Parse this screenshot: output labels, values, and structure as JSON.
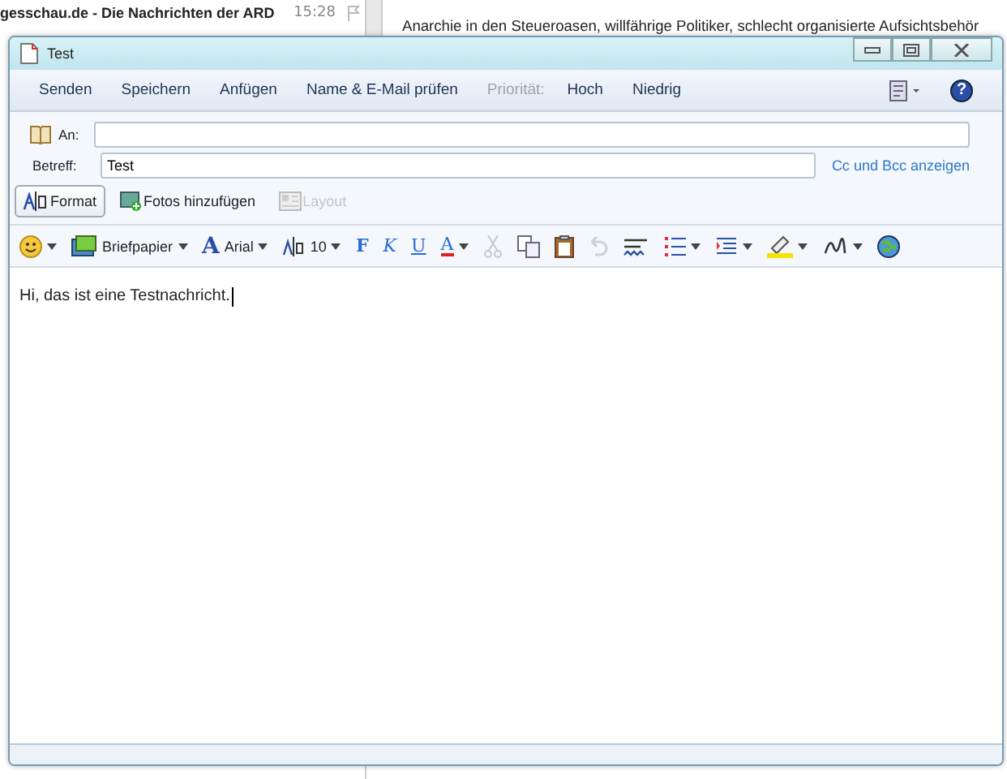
{
  "background": {
    "message_list": {
      "sender": "gesschau.de - Die Nachrichten der ARD",
      "time": "15:28"
    },
    "reading_pane": {
      "text": "Anarchie in den Steueroasen, willfährige Politiker, schlecht organisierte Aufsichtsbehör"
    }
  },
  "window": {
    "title": "Test"
  },
  "command_bar": [
    {
      "kind": "button",
      "label": "Senden"
    },
    {
      "kind": "button",
      "label": "Speichern"
    },
    {
      "kind": "button",
      "label": "Anfügen"
    },
    {
      "kind": "button",
      "label": "Name & E-Mail prüfen"
    },
    {
      "kind": "label",
      "label": "Priorität:"
    },
    {
      "kind": "button",
      "label": "Hoch"
    },
    {
      "kind": "button",
      "label": "Niedrig"
    }
  ],
  "help_button": {
    "label": "?"
  },
  "fields": {
    "to": {
      "label": "An:"
    },
    "subject": {
      "label": "Betreff:",
      "value": "Test"
    },
    "cc_link": "Cc und Bcc anzeigen"
  },
  "tabs": [
    {
      "label": "Format",
      "selected": true,
      "disabled": false
    },
    {
      "label": "Fotos hinzufügen",
      "selected": false,
      "disabled": false
    },
    {
      "label": "Layout",
      "selected": false,
      "disabled": true
    }
  ],
  "format_toolbar": [
    {
      "kind": "emoji",
      "dropdown": true,
      "disabled": false
    },
    {
      "kind": "stationery",
      "label": "Briefpapier",
      "dropdown": true,
      "disabled": false
    },
    {
      "kind": "font",
      "glyph": "A",
      "label": "Arial",
      "dropdown": true,
      "disabled": false
    },
    {
      "kind": "size",
      "label": "10",
      "dropdown": true,
      "disabled": false
    },
    {
      "kind": "bold",
      "label": "F",
      "dropdown": false,
      "disabled": false
    },
    {
      "kind": "italic",
      "label": "K",
      "dropdown": false,
      "disabled": false
    },
    {
      "kind": "underline",
      "label": "U",
      "dropdown": false,
      "disabled": false
    },
    {
      "kind": "color",
      "label": "A",
      "dropdown": true,
      "disabled": false
    },
    {
      "kind": "cut",
      "dropdown": false,
      "disabled": true
    },
    {
      "kind": "copy",
      "dropdown": false,
      "disabled": false
    },
    {
      "kind": "paste",
      "dropdown": false,
      "disabled": false
    },
    {
      "kind": "undo",
      "dropdown": false,
      "disabled": true
    },
    {
      "kind": "spelling",
      "dropdown": false,
      "disabled": false
    },
    {
      "kind": "list",
      "dropdown": true,
      "disabled": false
    },
    {
      "kind": "indent",
      "dropdown": true,
      "disabled": false
    },
    {
      "kind": "highlight",
      "dropdown": true,
      "disabled": false
    },
    {
      "kind": "signature",
      "dropdown": true,
      "disabled": false
    },
    {
      "kind": "link",
      "dropdown": false,
      "disabled": false
    }
  ],
  "body": {
    "text": "Hi, das ist eine Testnachricht."
  }
}
